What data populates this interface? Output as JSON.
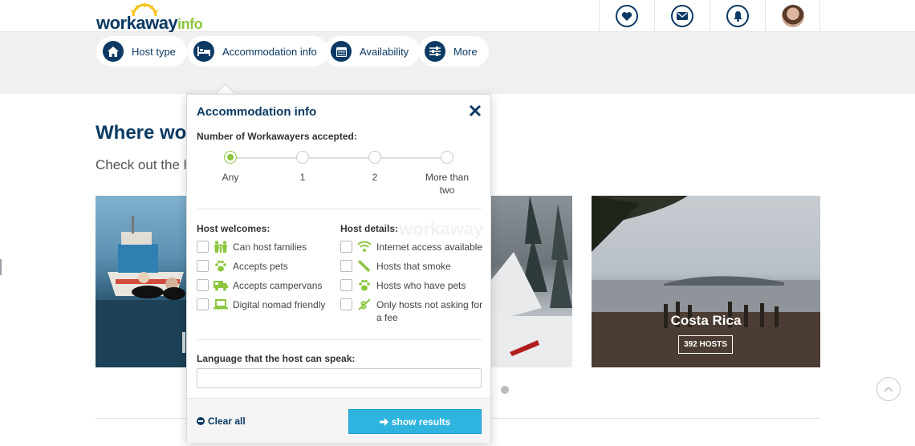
{
  "header": {
    "logo_main": "workaway",
    "logo_suffix": "info",
    "icons": [
      "heart-icon",
      "envelope-icon",
      "bell-icon",
      "avatar"
    ]
  },
  "filters": [
    {
      "label": "Host type",
      "icon": "home-icon"
    },
    {
      "label": "Accommodation info",
      "icon": "bed-icon"
    },
    {
      "label": "Availability",
      "icon": "calendar-icon"
    },
    {
      "label": "More",
      "icon": "sliders-icon"
    }
  ],
  "main": {
    "heading": "Where wou",
    "subheading": "Check out the h",
    "cards": [
      {
        "name": "Costa Rica",
        "hosts_label": "392 HOSTS"
      }
    ]
  },
  "popup": {
    "title": "Accommodation info",
    "workawayers_label": "Number of Workawayers accepted:",
    "slider_options": [
      "Any",
      "1",
      "2",
      "More than two"
    ],
    "slider_selected": "Any",
    "host_welcomes_label": "Host welcomes:",
    "host_welcomes": [
      {
        "label": "Can host families",
        "icon": "family-icon"
      },
      {
        "label": "Accepts pets",
        "icon": "paw-icon"
      },
      {
        "label": "Accepts campervans",
        "icon": "campervan-icon"
      },
      {
        "label": "Digital nomad friendly",
        "icon": "laptop-icon"
      }
    ],
    "host_details_label": "Host details:",
    "host_details": [
      {
        "label": "Internet access available",
        "icon": "wifi-icon"
      },
      {
        "label": "Hosts that smoke",
        "icon": "cigarette-icon"
      },
      {
        "label": "Hosts who have pets",
        "icon": "paw-icon"
      },
      {
        "label": "Only hosts not asking for a fee",
        "icon": "no-fee-icon"
      }
    ],
    "language_label": "Language that the host can speak:",
    "language_value": "",
    "clear_all": "Clear all",
    "show_results": "show results"
  },
  "colors": {
    "navy": "#0c3a64",
    "green": "#8dc63f",
    "button_blue": "#2fb4e0"
  }
}
